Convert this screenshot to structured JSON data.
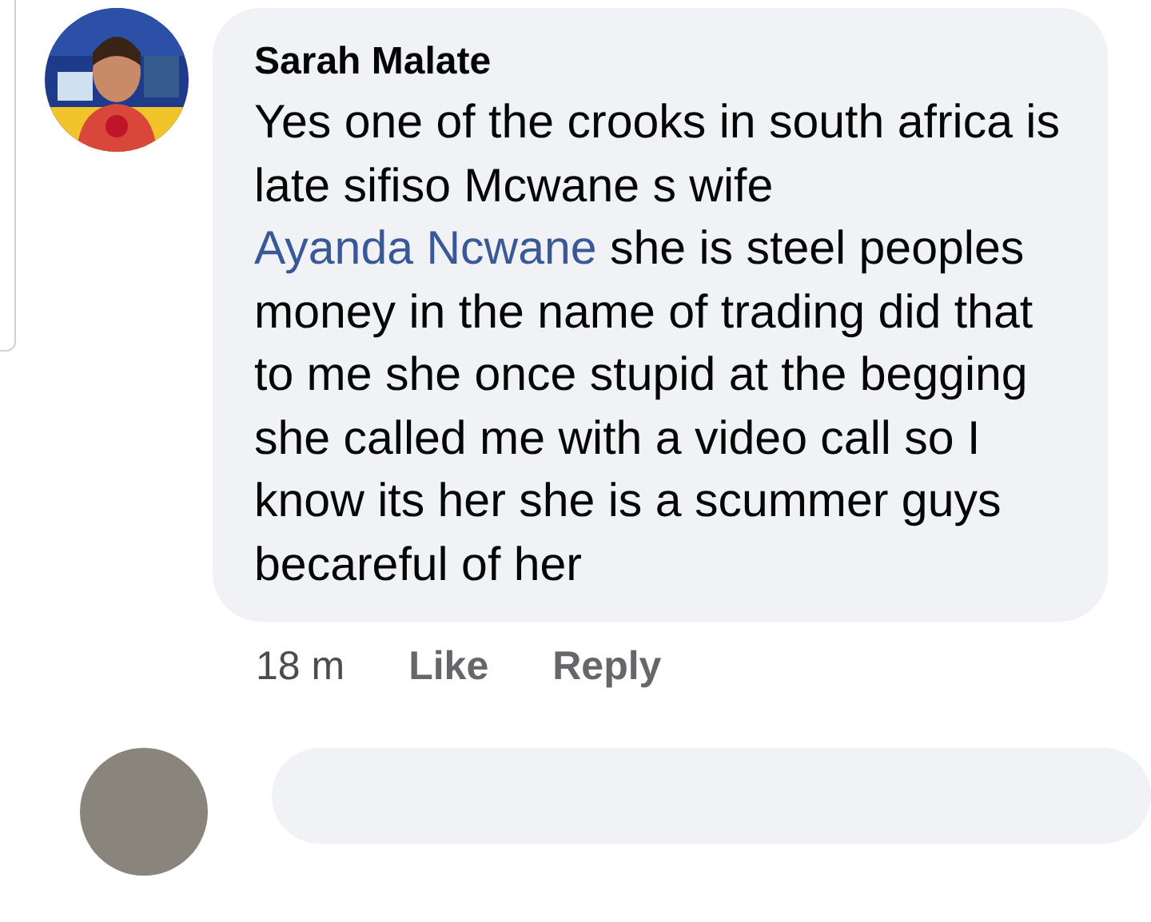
{
  "comment": {
    "author": "Sarah Malate",
    "text_before": "Yes one of the crooks in south africa is late sifiso Mcwane s wife",
    "mention": "Ayanda Ncwane",
    "text_after": "she is steel  peoples money in the name of trading did that to me she once  stupid at the begging she called me with a video call so I know its her she is a scummer guys becareful of her"
  },
  "actions": [
    {
      "label": "18 m",
      "kind": "time"
    },
    {
      "label": "Like",
      "kind": "action"
    },
    {
      "label": "Reply",
      "kind": "action"
    }
  ]
}
